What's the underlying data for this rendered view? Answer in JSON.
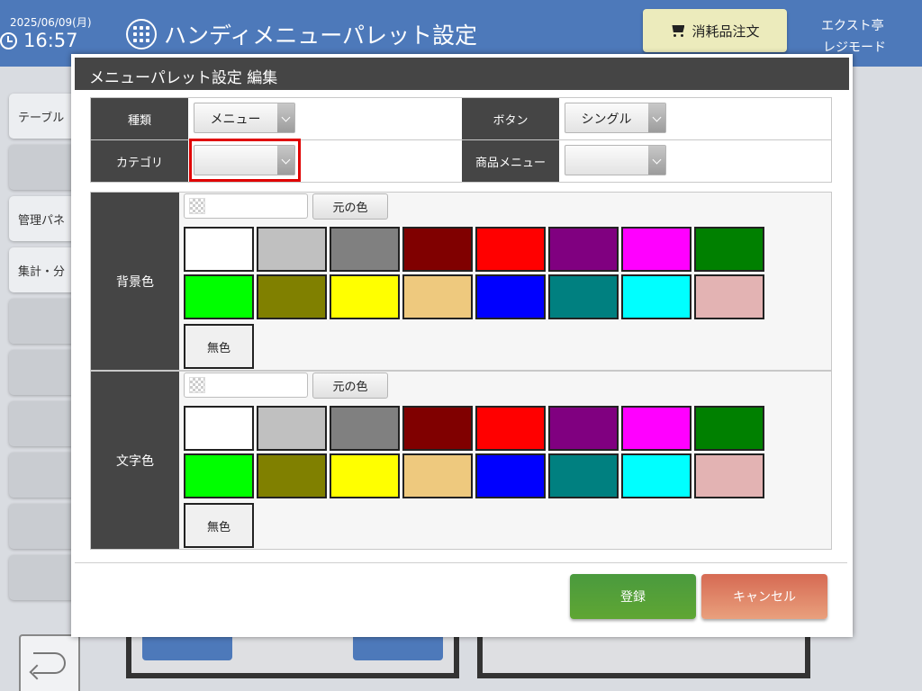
{
  "header": {
    "date": "2025/06/09(月)",
    "time": "16:57",
    "title": "ハンディメニューパレット設定",
    "order_button": "消耗品注文",
    "store_name": "エクスト亭",
    "mode": "レジモード"
  },
  "background_menu": {
    "items": [
      "テーブル",
      "",
      "管理パネ",
      "集計・分",
      "",
      "",
      "",
      "",
      "",
      ""
    ]
  },
  "modal": {
    "title": "メニューパレット設定 編集",
    "form": {
      "type_label": "種類",
      "type_value": "メニュー",
      "button_label": "ボタン",
      "button_value": "シングル",
      "category_label": "カテゴリ",
      "category_value": "",
      "product_menu_label": "商品メニュー",
      "product_menu_value": ""
    },
    "background_color": {
      "label": "背景色",
      "original_button": "元の色",
      "no_color": "無色"
    },
    "text_color": {
      "label": "文字色",
      "original_button": "元の色",
      "no_color": "無色"
    },
    "palette": [
      "#ffffff",
      "#c0c0c0",
      "#808080",
      "#800000",
      "#ff0000",
      "#800080",
      "#ff00ff",
      "#008000",
      "#00ff00",
      "#808000",
      "#ffff00",
      "#eec97e",
      "#0000ff",
      "#008080",
      "#00ffff",
      "#e3b3b3"
    ],
    "register_button": "登録",
    "cancel_button": "キャンセル"
  }
}
